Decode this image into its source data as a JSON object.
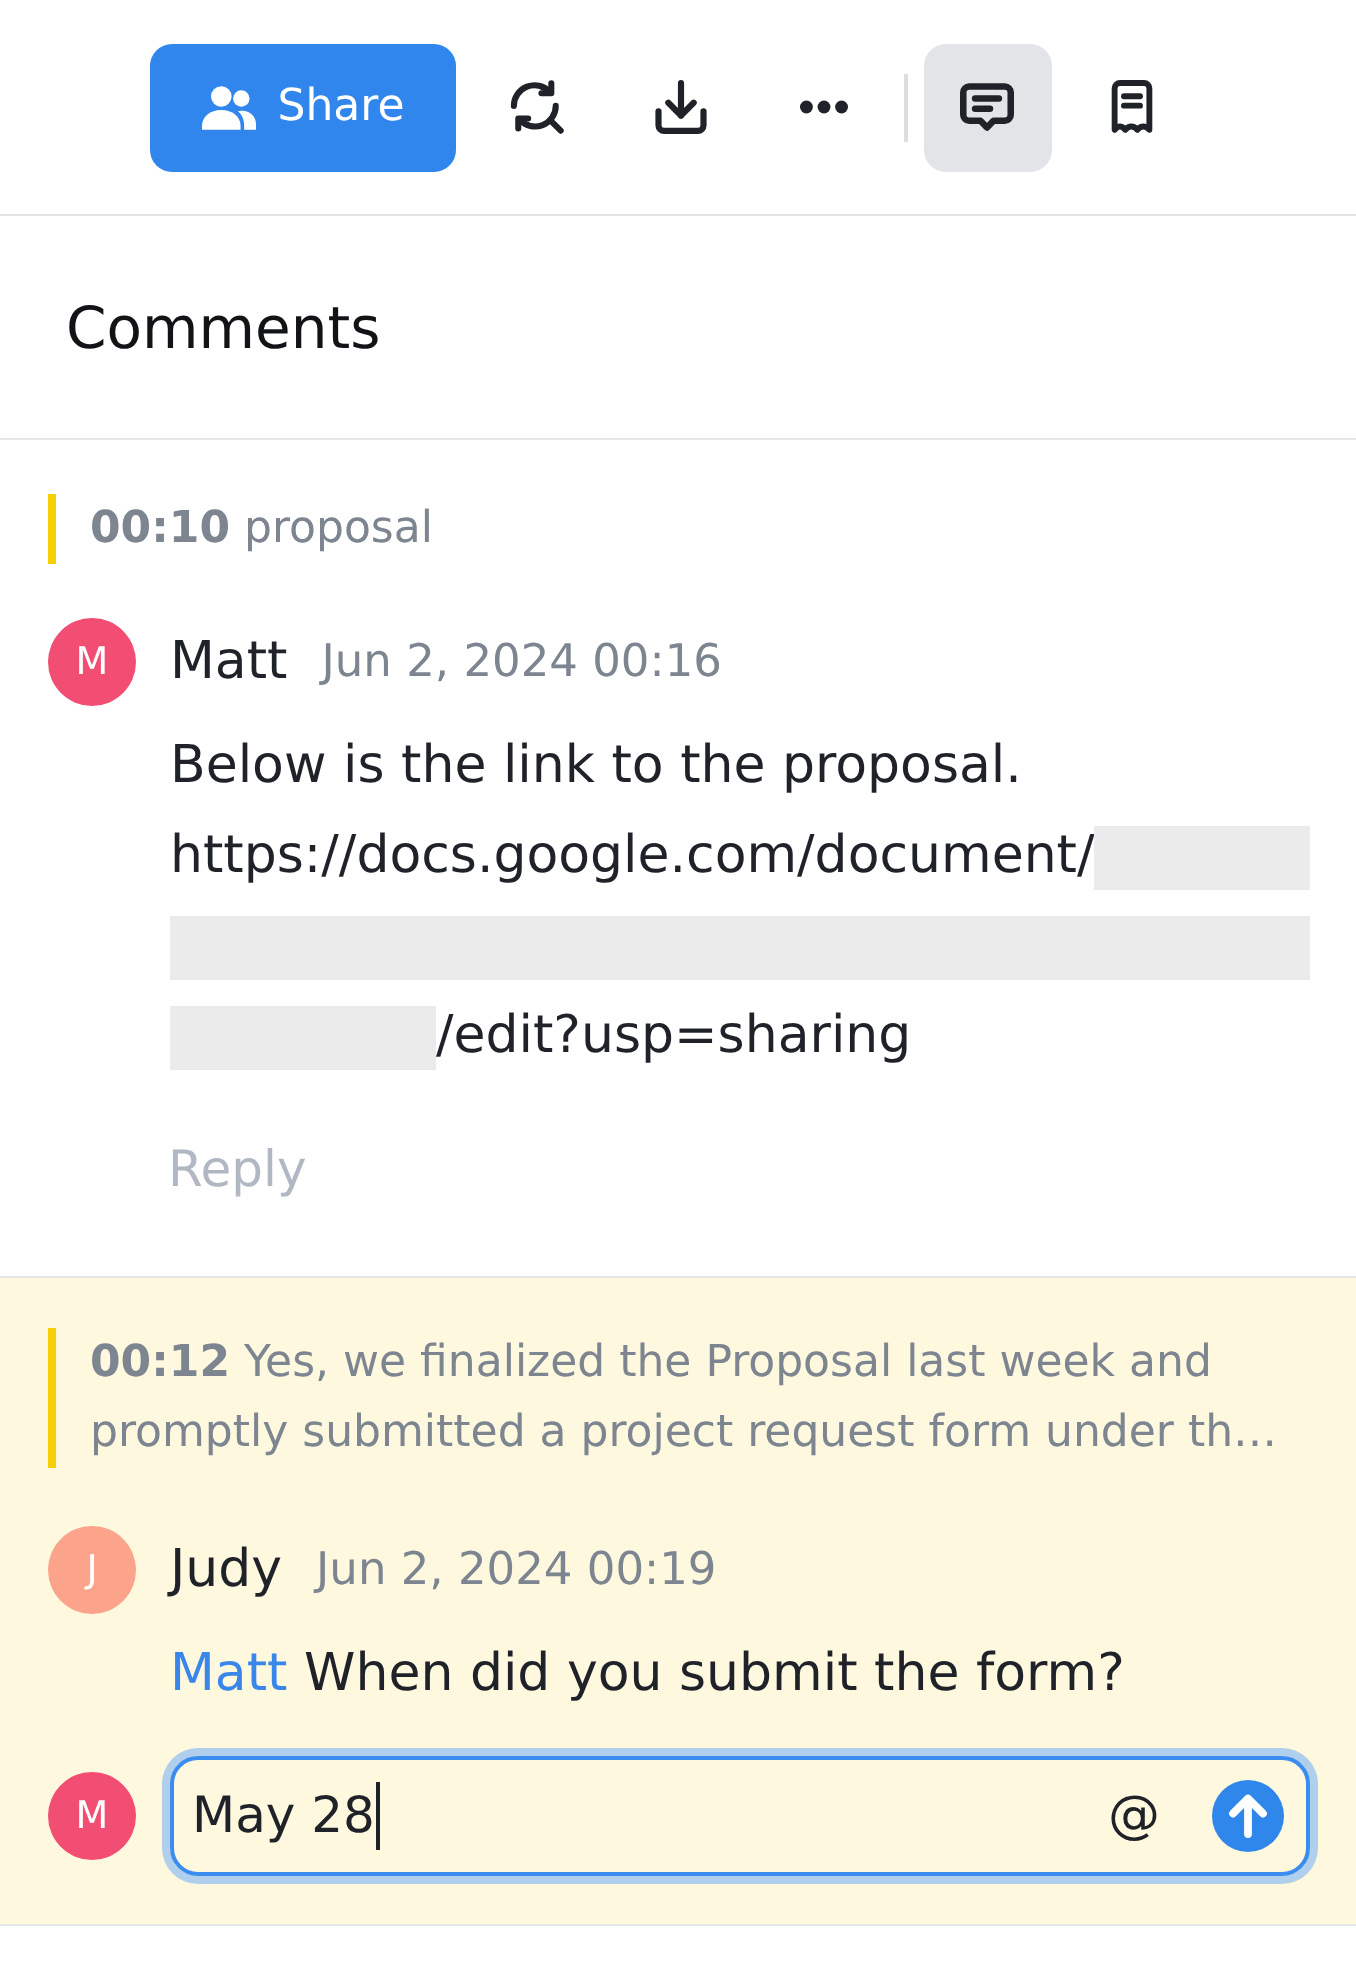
{
  "toolbar": {
    "share_button": "Share",
    "actions": [
      {
        "kind": "sync"
      },
      {
        "kind": "download"
      },
      {
        "kind": "more"
      }
    ],
    "panels": [
      {
        "kind": "comments",
        "selected": true
      },
      {
        "kind": "notes",
        "selected": false
      }
    ]
  },
  "header": {
    "title": "Comments"
  },
  "threads": [
    {
      "highlighted": false,
      "quote": "**00:10** proposal",
      "comments": [
        {
          "author": "Matt",
          "initial": "M",
          "color": "#f24d72",
          "date": "Jun 2, 2024 00:16",
          "lines": [
            {
              "segments": [
                {
                  "kind": "text",
                  "text": "Below is the link to the proposal."
                }
              ]
            },
            {
              "segments": [
                {
                  "kind": "text",
                  "text": "https://docs.google.com/document/"
                },
                {
                  "kind": "redacted"
                }
              ]
            },
            {
              "segments": [
                {
                  "kind": "redacted"
                }
              ]
            },
            {
              "segments": [
                {
                  "kind": "redacted_short"
                },
                {
                  "kind": "text",
                  "text": "/edit?usp=sharing"
                }
              ]
            }
          ]
        }
      ],
      "reply_button": "Reply"
    },
    {
      "highlighted": true,
      "quote": "**00:12** Yes, we finalized the Proposal last week and promptly submitted a project request form under th…",
      "comments": [
        {
          "author": "Judy",
          "initial": "J",
          "color": "#fba38b",
          "date": "Jun 2, 2024 00:19",
          "lines": [
            {
              "segments": [
                {
                  "kind": "mention",
                  "text": "Matt"
                },
                {
                  "kind": "text",
                  "text": "When did you submit the form?"
                }
              ]
            }
          ]
        }
      ],
      "composer": {
        "initial": "M",
        "color": "#f24d72",
        "value": "May 28",
        "focused": true,
        "mention_button": "@"
      }
    }
  ]
}
